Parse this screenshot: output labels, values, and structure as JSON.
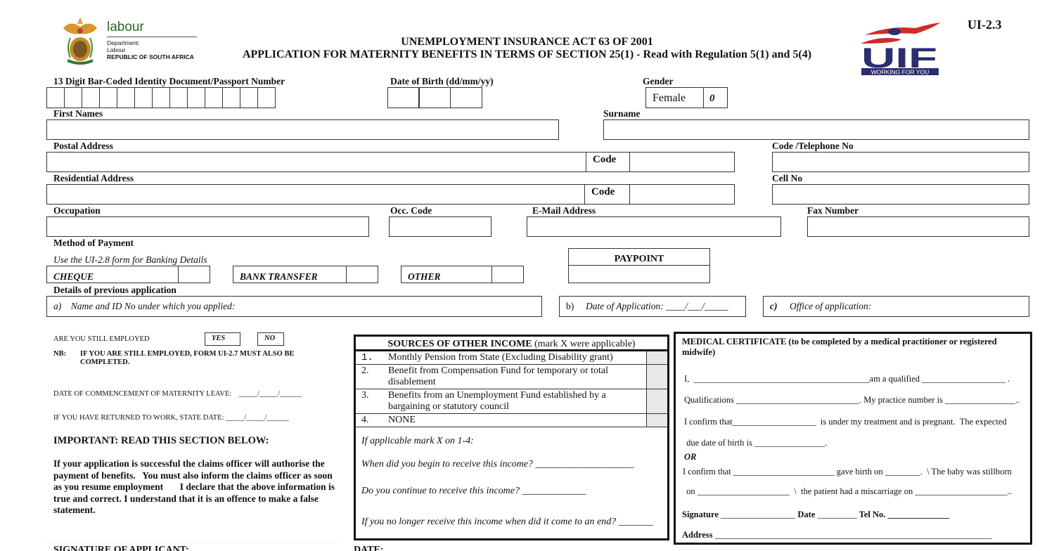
{
  "header": {
    "logo_left": {
      "word": "labour",
      "lines": [
        "Department:",
        "Labour",
        "REPUBLIC OF SOUTH AFRICA"
      ]
    },
    "logo_right": {
      "word": "UIF",
      "tagline": "WORKING FOR YOU"
    },
    "form_code": "UI-2.3",
    "title_line1": "UNEMPLOYMENT INSURANCE ACT 63 OF 2001",
    "title_line2": "APPLICATION FOR MATERNITY BENEFITS IN TERMS OF SECTION 25(1) -  Read with Regulation 5(1) and 5(4)"
  },
  "fields": {
    "id_number_label": "13 Digit Bar-Coded Identity Document/Passport Number",
    "id_digit_count": 13,
    "dob_label": "Date of Birth (dd/mm/yy)",
    "gender_label": "Gender",
    "gender_value": "Female",
    "gender_code": "0",
    "first_names_label": "First Names",
    "surname_label": "Surname",
    "postal_address_label": "Postal Address",
    "code_label": "Code",
    "telephone_label": "Code /Telephone No",
    "residential_address_label": "Residential Address",
    "cell_label": "Cell No",
    "occupation_label": "Occupation",
    "occ_code_label": "Occ. Code",
    "email_label": "E-Mail Address",
    "fax_label": "Fax Number"
  },
  "payment": {
    "label": "Method of Payment",
    "note": "Use the UI-2.8 form for Banking Details",
    "options": [
      "CHEQUE",
      "BANK TRANSFER",
      "OTHER"
    ],
    "paypoint_label": "PAYPOINT"
  },
  "previous_application": {
    "label": "Details of previous application",
    "a": "a)    Name and ID No under which you applied:",
    "b_prefix": "b)",
    "b": "Date of Application: ____/___/_____",
    "c_prefix": "c)",
    "c": "Office of application:"
  },
  "employment": {
    "question": "ARE YOU STILL EMPLOYED",
    "yes": "YES",
    "no": "NO",
    "nb_label": "NB:",
    "nb_text": "IF YOU ARE STILL EMPLOYED, FORM UI-2.7 MUST ALSO BE COMPLETED.",
    "leave_date": "DATE OF COMMENCEMENT OF MATERNITY LEAVE:    _____/_____/______",
    "returned_date": "IF YOU HAVE RETURNED TO WORK, STATE DATE: _____/_____/______",
    "important_heading": "IMPORTANT: READ THIS SECTION BELOW:",
    "important_text": "If your application is successful the claims officer will authorise the payment of benefits.   You must also inform the claims officer as soon as you resume employment       I declare that the above information is true and correct. I understand that it is an offence to make a false statement.",
    "signature_label": "SIGNATURE OF APPLICANT:",
    "date_label": "DATE:"
  },
  "income": {
    "title_bold": "SOURCES OF OTHER INCOME",
    "title_rest": " (mark X were applicable)",
    "items": [
      {
        "num": "1.",
        "text": "Monthly Pension from State (Excluding Disability grant)"
      },
      {
        "num": "2.",
        "text": "Benefit from Compensation Fund for temporary or total disablement"
      },
      {
        "num": "3.",
        "text": "Benefits from an Unemployment Fund established by a bargaining or statutory council"
      },
      {
        "num": "4.",
        "text": "NONE"
      }
    ],
    "if_applicable": "If applicable mark X on 1-4:",
    "q1": "When did you begin to receive this income? ____________________",
    "q2": "Do you continue to receive this income? _____________",
    "q3": "If you no longer receive this income when did it come to an end? _______"
  },
  "medical": {
    "title": "MEDICAL CERTIFICATE (to be completed by a medical practitioner or registered midwife)",
    "line1": "I,  ________________________________________am a qualified ___________________ .",
    "line2": "Qualifications ____________________________. My practice number is ________________..",
    "line3": "I confirm that___________________  is under my treatment and is pregnant.  The expected",
    "line4": " due date of birth is ________________.",
    "or": "OR",
    "line5": "I confirm that _______________________ gave birth on ________.  \\ The baby was stillborn",
    "line6": " on _____________________  \\  the patient had a miscarriage on _____________________..",
    "sig_label": "Signature",
    "sig_blank": "_________________",
    "date_label": "Date",
    "date_blank": "_________",
    "tel_label": "Tel No.",
    "tel_blank": "______________",
    "address_label": "Address",
    "address_blank": "_______________________________________________________________"
  }
}
